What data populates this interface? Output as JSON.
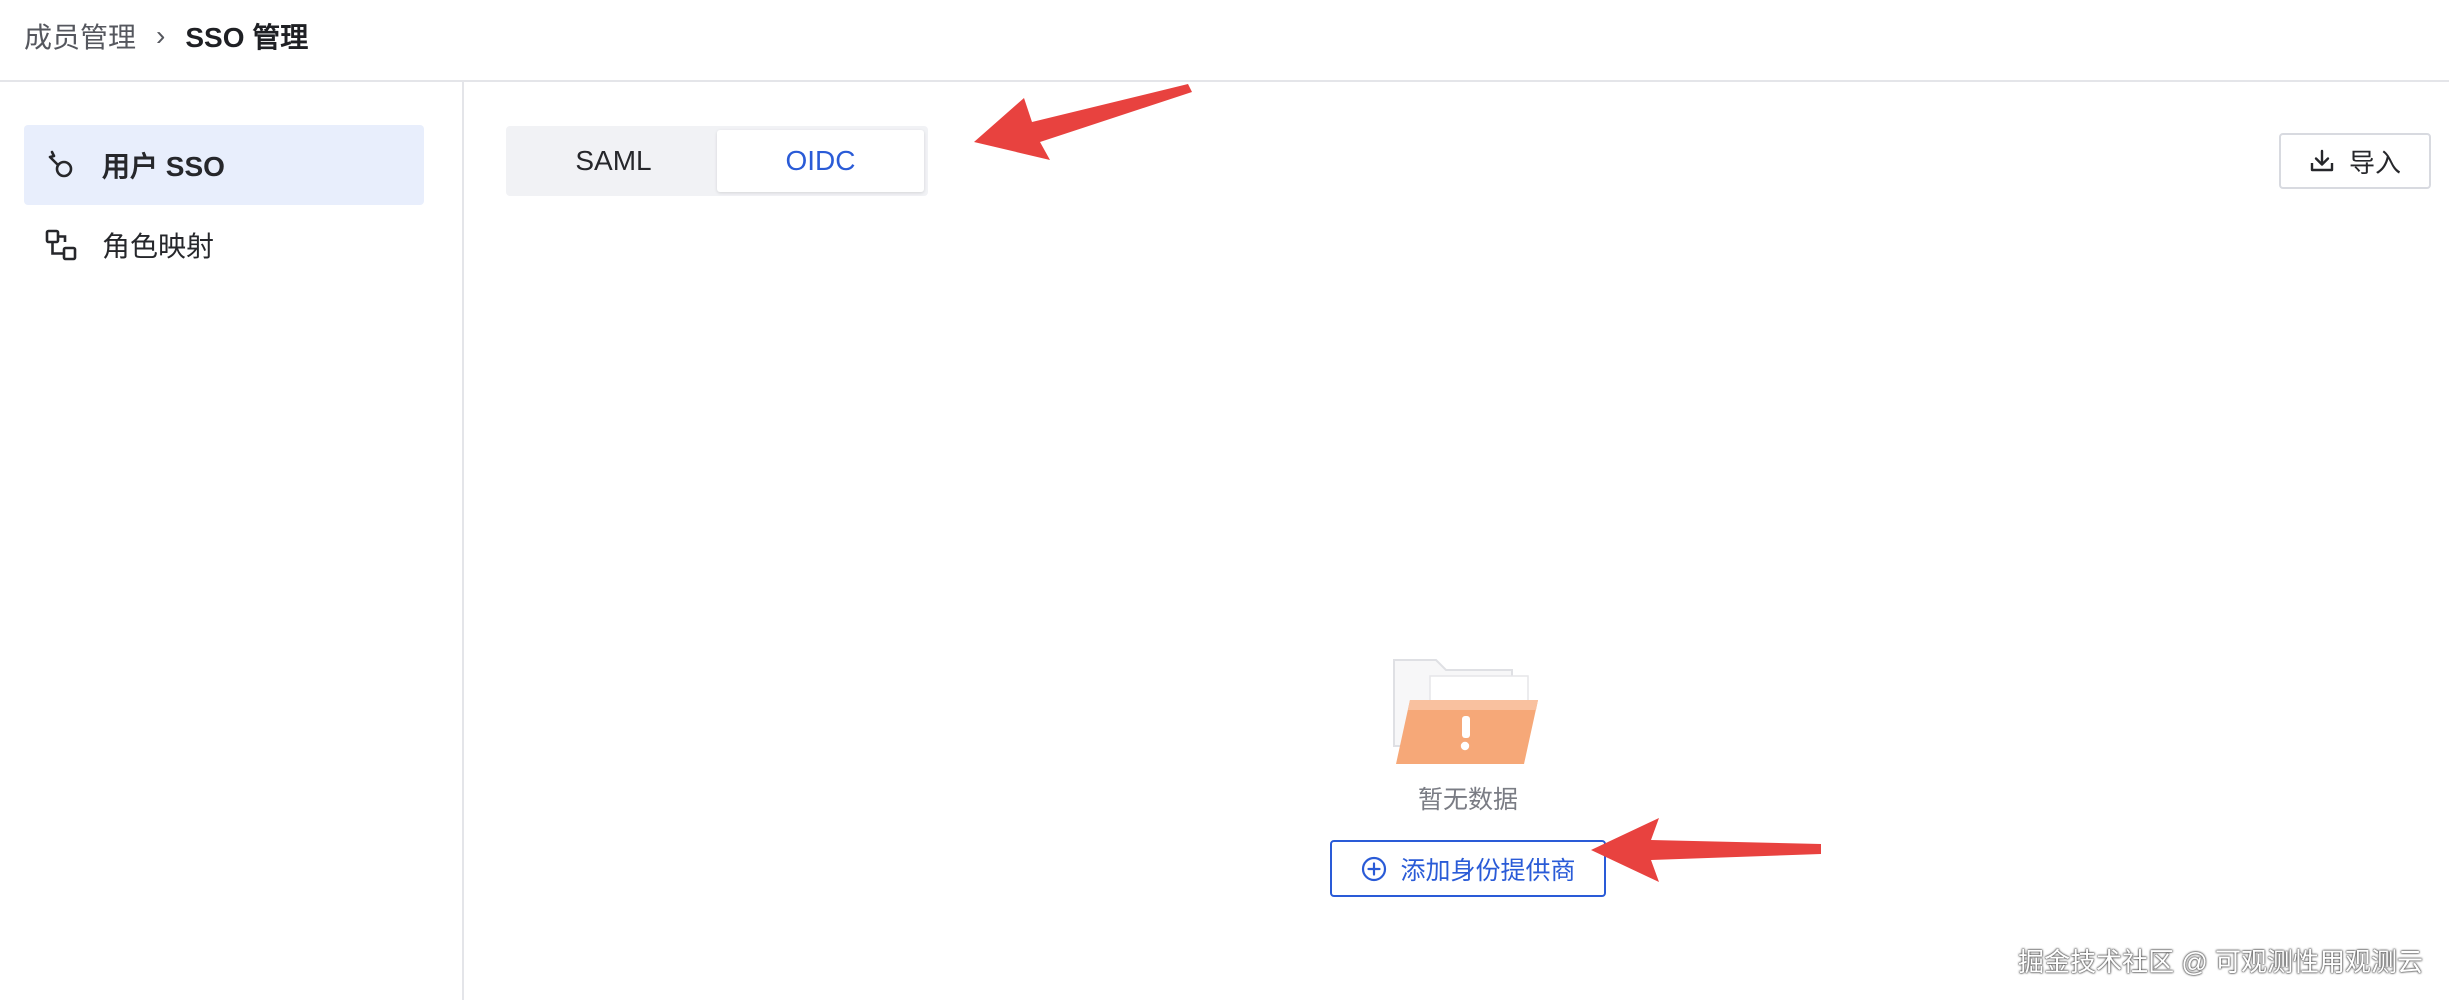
{
  "breadcrumb": {
    "parent": "成员管理",
    "separator": "›",
    "current": "SSO 管理"
  },
  "sidebar": {
    "items": [
      {
        "label": "用户 SSO",
        "icon": "user-sso-icon",
        "active": true
      },
      {
        "label": "角色映射",
        "icon": "role-mapping-icon",
        "active": false
      }
    ]
  },
  "tabs": [
    {
      "label": "SAML",
      "active": false
    },
    {
      "label": "OIDC",
      "active": true
    }
  ],
  "toolbar": {
    "import_label": "导入",
    "import_icon": "download-icon"
  },
  "empty_state": {
    "icon": "empty-folder-icon",
    "text": "暂无数据",
    "add_button_label": "添加身份提供商",
    "add_button_icon": "plus-circle-icon"
  },
  "annotations": {
    "arrow_color": "#e8423f"
  },
  "watermark": "掘金技术社区 @ 可观测性用观测云",
  "colors": {
    "accent": "#2a5bd7",
    "sidebar_active_bg": "#e8eefc",
    "folder": "#f6a878"
  }
}
